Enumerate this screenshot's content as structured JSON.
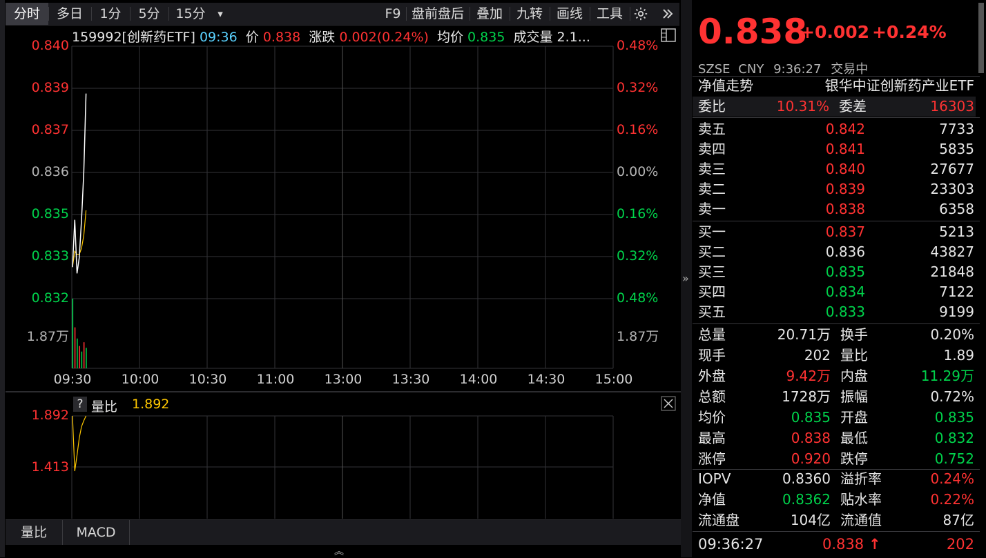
{
  "toolbar": {
    "left_tabs": [
      {
        "label": "分时",
        "active": true
      },
      {
        "label": "多日"
      },
      {
        "label": "1分"
      },
      {
        "label": "5分"
      },
      {
        "label": "15分"
      }
    ],
    "more_glyph": "▾",
    "right_tabs": [
      "F9",
      "盘前盘后",
      "叠加",
      "九转",
      "画线",
      "工具"
    ]
  },
  "info_bar": {
    "symbol": "159992[创新药ETF]",
    "time": "09:36",
    "price_label": "价",
    "price": "0.838",
    "change_label": "涨跌",
    "change": "0.002(0.24%)",
    "avg_label": "均价",
    "avg": "0.835",
    "vol_label": "成交量",
    "vol": "2.1..."
  },
  "main_axis": {
    "left": [
      {
        "t": "0.840",
        "c": "red"
      },
      {
        "t": "0.839",
        "c": "red"
      },
      {
        "t": "0.837",
        "c": "red"
      },
      {
        "t": "0.836",
        "c": "gray"
      },
      {
        "t": "0.835",
        "c": "green"
      },
      {
        "t": "0.833",
        "c": "green"
      },
      {
        "t": "0.832",
        "c": "green"
      }
    ],
    "right": [
      {
        "t": "0.48%",
        "c": "red"
      },
      {
        "t": "0.32%",
        "c": "red"
      },
      {
        "t": "0.16%",
        "c": "red"
      },
      {
        "t": "0.00%",
        "c": "gray"
      },
      {
        "t": "0.16%",
        "c": "green"
      },
      {
        "t": "0.32%",
        "c": "green"
      },
      {
        "t": "0.48%",
        "c": "green"
      }
    ],
    "vol_left": "1.87万",
    "vol_right": "1.87万",
    "time_ticks": [
      "09:30",
      "10:00",
      "10:30",
      "11:00",
      "13:00",
      "13:30",
      "14:00",
      "14:30",
      "15:00"
    ]
  },
  "sub_chart": {
    "help": "?",
    "name": "量比",
    "value": "1.892",
    "axis": [
      "1.892",
      "1.413"
    ]
  },
  "bottom_tabs": [
    "量比",
    "MACD"
  ],
  "expand_glyph": "»",
  "collapse_glyph": "︽",
  "chart_data": {
    "type": "line",
    "x_minutes": [
      0,
      1,
      2,
      3,
      4,
      5,
      6
    ],
    "price": [
      0.833,
      0.8345,
      0.8328,
      0.8333,
      0.8345,
      0.836,
      0.8385
    ],
    "avg_price": [
      0.833,
      0.8335,
      0.8334,
      0.8334,
      0.8336,
      0.834,
      0.8348
    ],
    "volume_wan": [
      1.87,
      1.1,
      0.8,
      0.6,
      0.45,
      0.7,
      0.55
    ],
    "ylim": [
      0.832,
      0.84
    ],
    "vol_ratio": [
      1.892,
      1.413,
      1.55,
      1.7,
      1.8,
      1.85,
      1.892
    ],
    "vol_ratio_lim": [
      1.0,
      1.892
    ]
  },
  "quote": {
    "price": "0.838",
    "change": "+0.002",
    "change_pct": "+0.24%",
    "exchange": "SZSE",
    "currency": "CNY",
    "time": "9:36:27",
    "status": "交易中",
    "nav_trend_label": "净值走势",
    "fund_name": "银华中证创新药产业ETF",
    "weibi_label": "委比",
    "weibi": "10.31%",
    "weicha_label": "委差",
    "weicha": "16303",
    "asks": [
      {
        "label": "卖五",
        "price": "0.842",
        "vol": "7733",
        "c": "red"
      },
      {
        "label": "卖四",
        "price": "0.841",
        "vol": "5835",
        "c": "red"
      },
      {
        "label": "卖三",
        "price": "0.840",
        "vol": "27677",
        "c": "red"
      },
      {
        "label": "卖二",
        "price": "0.839",
        "vol": "23303",
        "c": "red"
      },
      {
        "label": "卖一",
        "price": "0.838",
        "vol": "6358",
        "c": "red"
      }
    ],
    "bids": [
      {
        "label": "买一",
        "price": "0.837",
        "vol": "5213",
        "c": "red"
      },
      {
        "label": "买二",
        "price": "0.836",
        "vol": "43827",
        "c": "white"
      },
      {
        "label": "买三",
        "price": "0.835",
        "vol": "21848",
        "c": "green"
      },
      {
        "label": "买四",
        "price": "0.834",
        "vol": "7122",
        "c": "green"
      },
      {
        "label": "买五",
        "price": "0.833",
        "vol": "9199",
        "c": "green"
      }
    ],
    "stats": [
      {
        "l1": "总量",
        "v1": "20.71万",
        "c1": "white",
        "l2": "换手",
        "v2": "0.20%",
        "c2": "white"
      },
      {
        "l1": "现手",
        "v1": "202",
        "c1": "white",
        "l2": "量比",
        "v2": "1.89",
        "c2": "white"
      },
      {
        "l1": "外盘",
        "v1": "9.42万",
        "c1": "red",
        "l2": "内盘",
        "v2": "11.29万",
        "c2": "green"
      },
      {
        "l1": "总额",
        "v1": "1728万",
        "c1": "white",
        "l2": "振幅",
        "v2": "0.72%",
        "c2": "white"
      },
      {
        "l1": "均价",
        "v1": "0.835",
        "c1": "green",
        "l2": "开盘",
        "v2": "0.835",
        "c2": "green"
      },
      {
        "l1": "最高",
        "v1": "0.838",
        "c1": "red",
        "l2": "最低",
        "v2": "0.832",
        "c2": "green"
      },
      {
        "l1": "涨停",
        "v1": "0.920",
        "c1": "red",
        "l2": "跌停",
        "v2": "0.752",
        "c2": "green"
      }
    ],
    "etf_stats": [
      {
        "l1": "IOPV",
        "v1": "0.8360",
        "c1": "white",
        "l2": "溢折率",
        "v2": "0.24%",
        "c2": "red"
      },
      {
        "l1": "净值",
        "v1": "0.8362",
        "c1": "green",
        "l2": "贴水率",
        "v2": "0.22%",
        "c2": "red"
      },
      {
        "l1": "流通盘",
        "v1": "104亿",
        "c1": "white",
        "l2": "流通值",
        "v2": "87亿",
        "c2": "white"
      }
    ],
    "last_tick": {
      "time": "09:36:27",
      "price": "0.838",
      "arrow": "↑",
      "vol": "202"
    }
  },
  "colors": {
    "red": "#ff3232",
    "green": "#00d24b",
    "gold": "#ffc800",
    "grid": "#333338"
  }
}
